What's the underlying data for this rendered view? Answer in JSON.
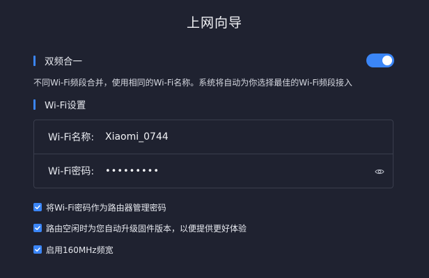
{
  "header": {
    "title": "上网向导"
  },
  "dual_band": {
    "label": "双频合一",
    "enabled": true,
    "description": "不同Wi-Fi频段合并，使用相同的Wi-Fi名称。系统将自动为你选择最佳的Wi-Fi频段接入"
  },
  "wifi_settings": {
    "heading": "Wi-Fi设置",
    "name_label": "Wi-Fi名称:",
    "name_value": "Xiaomi_0744",
    "password_label": "Wi-Fi密码:",
    "password_value": "•••••••••",
    "eye_icon": "eye-icon"
  },
  "options": [
    {
      "label": "将Wi-Fi密码作为路由器管理密码",
      "checked": true
    },
    {
      "label": "路由空闲时为您自动升级固件版本，以便提供更好体验",
      "checked": true
    },
    {
      "label": "启用160MHz频宽",
      "checked": true
    }
  ],
  "colors": {
    "background": "#1f2230",
    "accent": "#3b86f7",
    "border": "#3a3e4d"
  }
}
